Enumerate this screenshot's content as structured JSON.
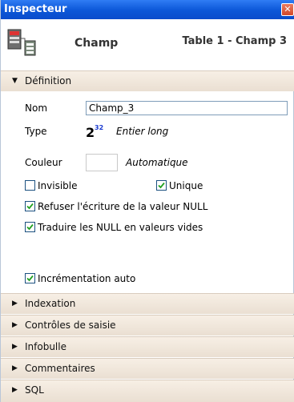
{
  "window": {
    "title": "Inspecteur",
    "close_label": "✕"
  },
  "header": {
    "title": "Champ",
    "path": "Table 1 - Champ 3"
  },
  "definition": {
    "label": "Définition",
    "name_label": "Nom",
    "name_value": "Champ_3",
    "type_label": "Type",
    "type_value": "Entier long",
    "color_label": "Couleur",
    "color_value": "Automatique",
    "checkboxes": {
      "invisible": {
        "label": "Invisible",
        "checked": false
      },
      "unique": {
        "label": "Unique",
        "checked": true
      },
      "refuse_null": {
        "label": "Refuser l'écriture de la valeur NULL",
        "checked": true
      },
      "null_to_empty": {
        "label": "Traduire les NULL en valeurs vides",
        "checked": true
      },
      "auto_increment": {
        "label": "Incrémentation auto",
        "checked": true
      }
    }
  },
  "sections": [
    {
      "label": "Indexation"
    },
    {
      "label": "Contrôles de saisie"
    },
    {
      "label": "Infobulle"
    },
    {
      "label": "Commentaires"
    },
    {
      "label": "SQL"
    }
  ],
  "colors": {
    "titlebar": "#0b56d7",
    "section_bg": "#f1e9df",
    "check": "#21a121"
  },
  "icons": {
    "expanded": "triangle-down-icon",
    "collapsed": "triangle-right-icon"
  }
}
